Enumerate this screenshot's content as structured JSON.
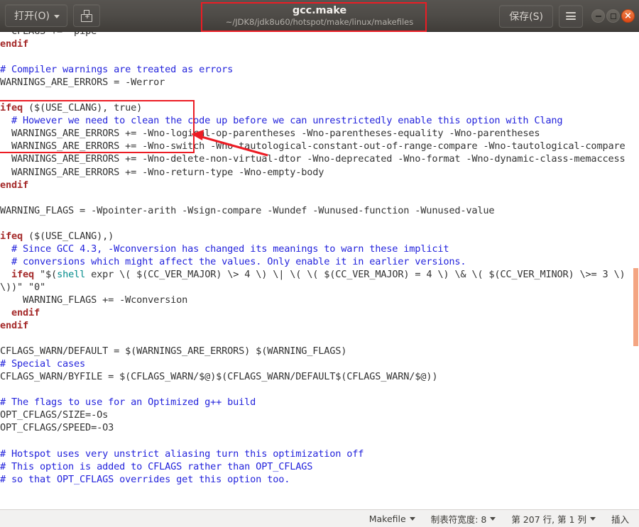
{
  "titlebar": {
    "open_label": "打开(O)",
    "save_as_icon": "save-as-disk-icon",
    "title": "gcc.make",
    "subtitle": "~/JDK8/jdk8u60/hotspot/make/linux/makefiles",
    "save_label": "保存(S)",
    "menu_icon": "hamburger-menu-icon",
    "minimize_icon": "minimize-icon",
    "maximize_icon": "maximize-icon",
    "close_icon": "close-icon",
    "close_color": "#dd4814",
    "highlight_color": "#ec1c24"
  },
  "statusbar": {
    "filetype": "Makefile",
    "tabwidth": "制表符宽度: 8",
    "position": "第 207 行, 第 1 列",
    "insert_mode": "插入"
  },
  "editor": {
    "background": "#ffffff",
    "comment_color": "#2323dc",
    "keyword_color": "#a52a2a",
    "function_color": "#008b8b",
    "text_color": "#333333",
    "scrollbar_thumb_color": "#f4a582",
    "lines": [
      {
        "segs": [
          {
            "t": "  CFLAGS += -pipe",
            "c": "c-plain"
          }
        ]
      },
      {
        "segs": [
          {
            "t": "endif",
            "c": "c-kw"
          }
        ]
      },
      {
        "segs": [
          {
            "t": "",
            "c": "c-plain"
          }
        ]
      },
      {
        "segs": [
          {
            "t": "# Compiler warnings are treated as errors",
            "c": "c-comment"
          }
        ]
      },
      {
        "segs": [
          {
            "t": "WARNINGS_ARE_ERRORS = -Werror",
            "c": "c-plain"
          }
        ]
      },
      {
        "segs": [
          {
            "t": "",
            "c": "c-plain"
          }
        ]
      },
      {
        "segs": [
          {
            "t": "ifeq",
            "c": "c-kw"
          },
          {
            "t": " ($(USE_CLANG), true)",
            "c": "c-plain"
          }
        ]
      },
      {
        "segs": [
          {
            "t": "  # However we need to clean the code up before we can unrestrictedly enable this option with Clang",
            "c": "c-comment"
          }
        ]
      },
      {
        "segs": [
          {
            "t": "  WARNINGS_ARE_ERRORS += -Wno-logical-op-parentheses -Wno-parentheses-equality -Wno-parentheses",
            "c": "c-plain"
          }
        ]
      },
      {
        "segs": [
          {
            "t": "  WARNINGS_ARE_ERRORS += -Wno-switch -Wno-tautological-constant-out-of-range-compare -Wno-tautological-compare",
            "c": "c-plain"
          }
        ]
      },
      {
        "segs": [
          {
            "t": "  WARNINGS_ARE_ERRORS += -Wno-delete-non-virtual-dtor -Wno-deprecated -Wno-format -Wno-dynamic-class-memaccess",
            "c": "c-plain"
          }
        ]
      },
      {
        "caret": true,
        "segs": [
          {
            "t": "  WARNINGS_ARE_ERRORS += -Wno-return-type -Wno-empty-body",
            "c": "c-plain"
          }
        ]
      },
      {
        "segs": [
          {
            "t": "endif",
            "c": "c-kw"
          }
        ]
      },
      {
        "segs": [
          {
            "t": "",
            "c": "c-plain"
          }
        ]
      },
      {
        "segs": [
          {
            "t": "WARNING_FLAGS = -Wpointer-arith -Wsign-compare -Wundef -Wunused-function -Wunused-value",
            "c": "c-plain"
          }
        ]
      },
      {
        "segs": [
          {
            "t": "",
            "c": "c-plain"
          }
        ]
      },
      {
        "segs": [
          {
            "t": "ifeq",
            "c": "c-kw"
          },
          {
            "t": " ($(USE_CLANG),)",
            "c": "c-plain"
          }
        ]
      },
      {
        "segs": [
          {
            "t": "  # Since GCC 4.3, -Wconversion has changed its meanings to warn these implicit",
            "c": "c-comment"
          }
        ]
      },
      {
        "segs": [
          {
            "t": "  # conversions which might affect the values. Only enable it in earlier versions.",
            "c": "c-comment"
          }
        ]
      },
      {
        "segs": [
          {
            "t": "  ifeq",
            "c": "c-kw"
          },
          {
            "t": " \"$(",
            "c": "c-plain"
          },
          {
            "t": "shell",
            "c": "c-func"
          },
          {
            "t": " expr \\( $(CC_VER_MAJOR) \\> 4 \\) \\| \\( \\( $(CC_VER_MAJOR) = 4 \\) \\& \\( $(CC_VER_MINOR) \\>= 3 \\) \\))\" \"0\"",
            "c": "c-plain"
          }
        ]
      },
      {
        "segs": [
          {
            "t": "    WARNING_FLAGS += -Wconversion",
            "c": "c-plain"
          }
        ]
      },
      {
        "segs": [
          {
            "t": "  endif",
            "c": "c-kw"
          }
        ]
      },
      {
        "segs": [
          {
            "t": "endif",
            "c": "c-kw"
          }
        ]
      },
      {
        "segs": [
          {
            "t": "",
            "c": "c-plain"
          }
        ]
      },
      {
        "segs": [
          {
            "t": "CFLAGS_WARN/DEFAULT = $(WARNINGS_ARE_ERRORS) $(WARNING_FLAGS)",
            "c": "c-plain"
          }
        ]
      },
      {
        "segs": [
          {
            "t": "# Special cases",
            "c": "c-comment"
          }
        ]
      },
      {
        "segs": [
          {
            "t": "CFLAGS_WARN/BYFILE = $(CFLAGS_WARN/$@)$(CFLAGS_WARN/DEFAULT$(CFLAGS_WARN/$@))",
            "c": "c-plain"
          }
        ]
      },
      {
        "segs": [
          {
            "t": "",
            "c": "c-plain"
          }
        ]
      },
      {
        "segs": [
          {
            "t": "# The flags to use for an Optimized g++ build",
            "c": "c-comment"
          }
        ]
      },
      {
        "segs": [
          {
            "t": "OPT_CFLAGS/SIZE=-Os",
            "c": "c-plain"
          }
        ]
      },
      {
        "segs": [
          {
            "t": "OPT_CFLAGS/SPEED=-O3",
            "c": "c-plain"
          }
        ]
      },
      {
        "segs": [
          {
            "t": "",
            "c": "c-plain"
          }
        ]
      },
      {
        "segs": [
          {
            "t": "# Hotspot uses very unstrict aliasing turn this optimization off",
            "c": "c-comment"
          }
        ]
      },
      {
        "segs": [
          {
            "t": "# This option is added to CFLAGS rather than OPT_CFLAGS",
            "c": "c-comment"
          }
        ]
      },
      {
        "segs": [
          {
            "t": "# so that OPT_CFLAGS overrides get this option too.",
            "c": "c-comment"
          }
        ]
      }
    ]
  }
}
